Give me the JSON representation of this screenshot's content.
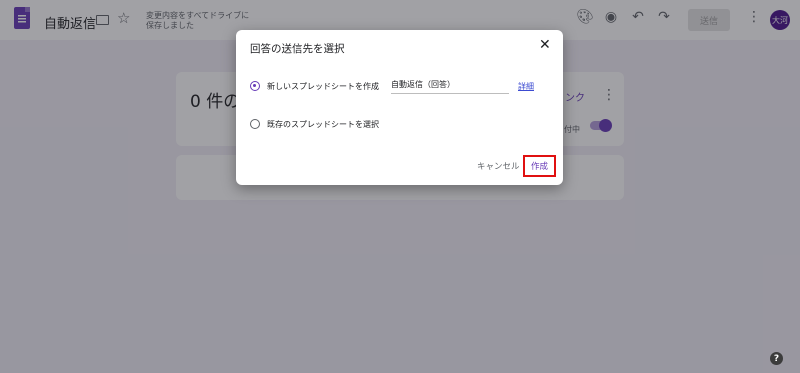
{
  "header": {
    "doc_title": "自動返信",
    "save_status": "変更内容をすべてドライブに\n保存しました",
    "send_label": "送信",
    "avatar_text": "大河",
    "icons": [
      "palette-icon",
      "preview-eye-icon",
      "undo-icon",
      "redo-icon",
      "more-vert-icon"
    ]
  },
  "background": {
    "responses_count": "0 件の",
    "link_fragment": "ンク",
    "accepting_fragment": "付中"
  },
  "dialog": {
    "title": "回答の送信先を選択",
    "option_new": "新しいスプレッドシートを作成",
    "new_sheet_name": "自動返信（回答）",
    "details_link": "詳細",
    "option_existing": "既存のスプレッドシートを選択",
    "cancel_label": "キャンセル",
    "create_label": "作成"
  },
  "colors": {
    "accent": "#673ab7",
    "highlight_border": "#e01010"
  }
}
